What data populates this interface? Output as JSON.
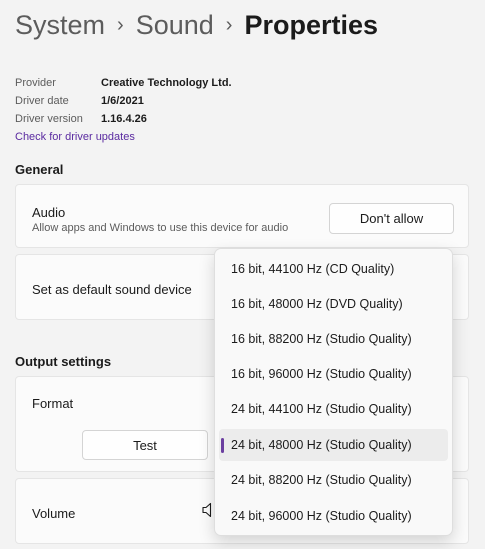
{
  "breadcrumb": {
    "items": [
      "System",
      "Sound"
    ],
    "separator": "›",
    "current": "Properties"
  },
  "driver_info": {
    "rows": [
      {
        "label": "Provider",
        "value": "Creative Technology Ltd."
      },
      {
        "label": "Driver date",
        "value": "1/6/2021"
      },
      {
        "label": "Driver version",
        "value": "1.16.4.26"
      }
    ],
    "update_link": "Check for driver updates"
  },
  "general": {
    "title": "General",
    "audio": {
      "title": "Audio",
      "subtitle": "Allow apps and Windows to use this device for audio",
      "button": "Don't allow"
    },
    "default_device": {
      "title": "Set as default sound device"
    }
  },
  "output": {
    "title": "Output settings",
    "format": {
      "title": "Format",
      "test_button": "Test"
    },
    "volume": {
      "title": "Volume",
      "icon": "speaker-icon"
    }
  },
  "format_dropdown": {
    "options": [
      "16 bit, 44100 Hz (CD Quality)",
      "16 bit, 48000 Hz (DVD Quality)",
      "16 bit, 88200 Hz (Studio Quality)",
      "16 bit, 96000 Hz (Studio Quality)",
      "24 bit, 44100 Hz (Studio Quality)",
      "24 bit, 48000 Hz (Studio Quality)",
      "24 bit, 88200 Hz (Studio Quality)",
      "24 bit, 96000 Hz (Studio Quality)"
    ],
    "selected_index": 5
  },
  "colors": {
    "accent": "#6b3fa0",
    "link": "#5a2aa0",
    "background": "#f3f3f3",
    "card": "#fbfbfb"
  }
}
